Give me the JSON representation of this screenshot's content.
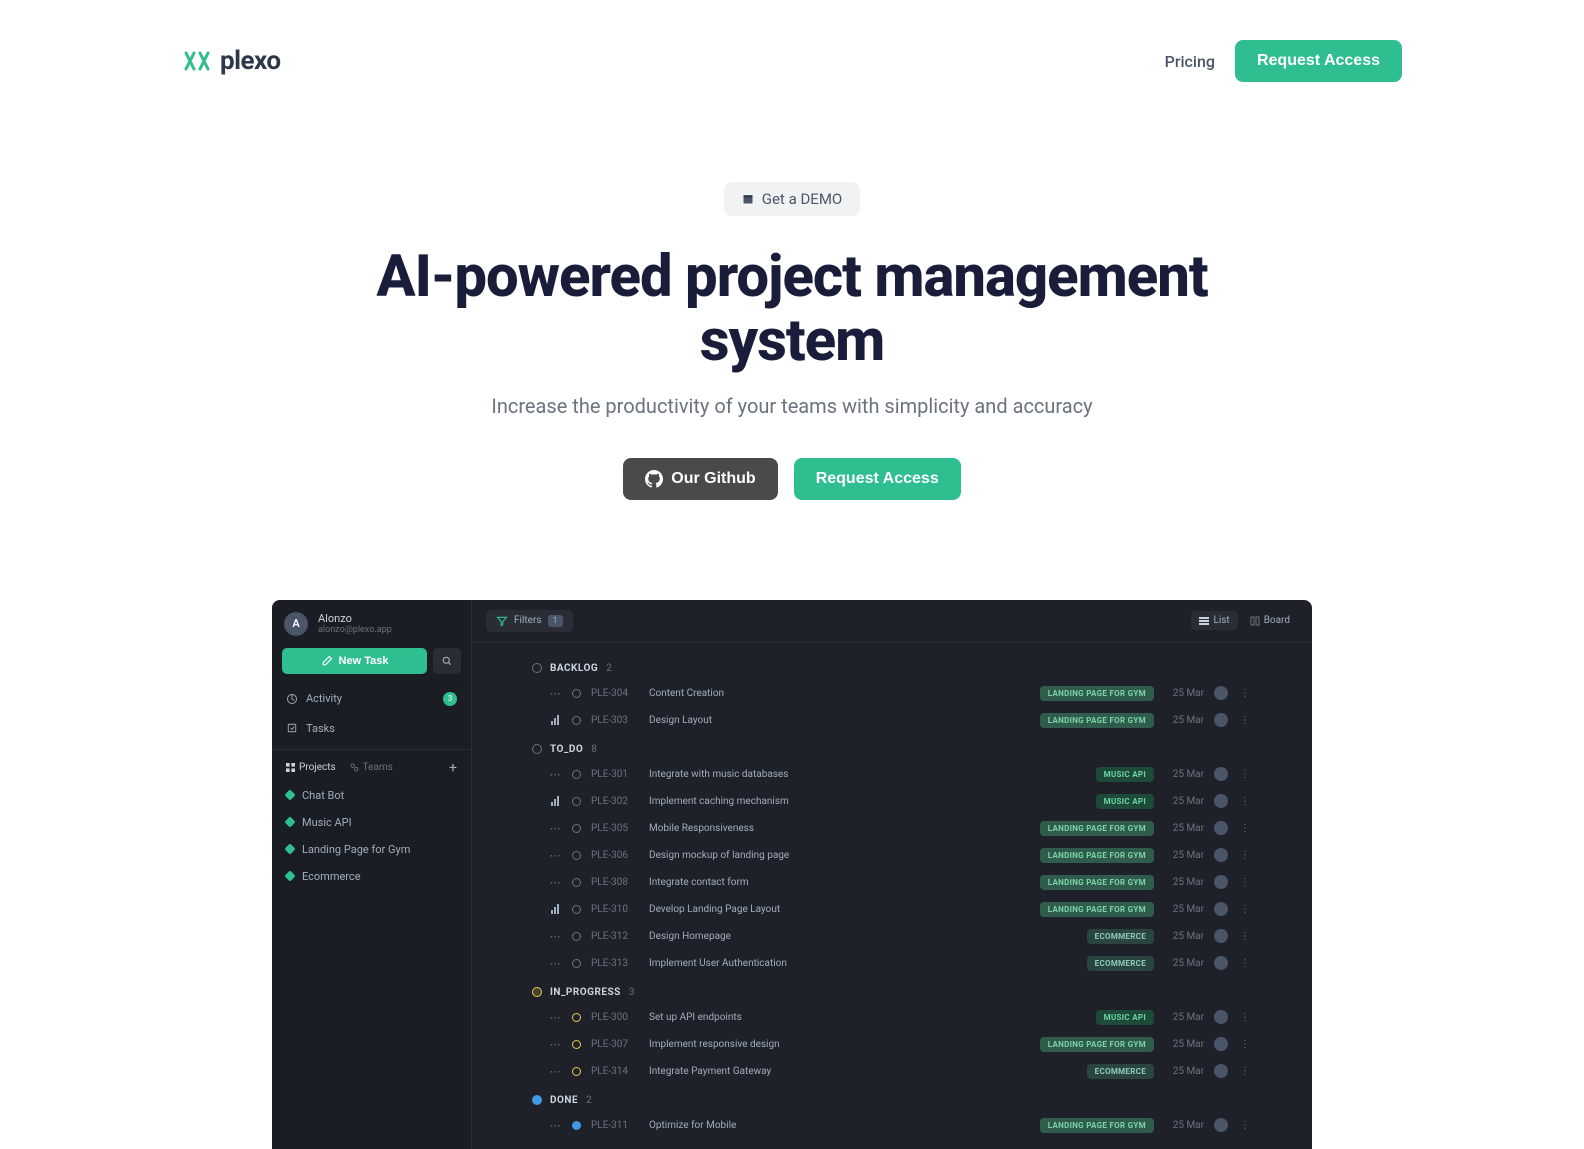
{
  "brand": "plexo",
  "nav": {
    "pricing": "Pricing",
    "request_access": "Request Access"
  },
  "hero": {
    "demo_label": "Get a DEMO",
    "title": "AI-powered project management system",
    "subtitle": "Increase the productivity of your teams with simplicity and accuracy",
    "github_btn": "Our Github",
    "request_btn": "Request Access"
  },
  "app": {
    "user": {
      "initial": "A",
      "name": "Alonzo",
      "email": "alonzo@plexo.app"
    },
    "new_task": "New Task",
    "side_nav": {
      "activity": "Activity",
      "activity_count": "3",
      "tasks": "Tasks"
    },
    "side_tabs": {
      "projects": "Projects",
      "teams": "Teams"
    },
    "projects": [
      "Chat Bot",
      "Music API",
      "Landing Page for Gym",
      "Ecommerce"
    ],
    "filters": {
      "label": "Filters",
      "count": "1"
    },
    "views": {
      "list": "List",
      "board": "Board"
    },
    "sections": [
      {
        "key": "backlog",
        "label": "BACKLOG",
        "count": "2",
        "status": "default",
        "tasks": [
          {
            "pri": "dots",
            "id": "PLE-304",
            "title": "Content Creation",
            "tag": "LANDING PAGE FOR GYM",
            "tagcls": "gym",
            "date": "25 Mar"
          },
          {
            "pri": "bars",
            "id": "PLE-303",
            "title": "Design Layout",
            "tag": "LANDING PAGE FOR GYM",
            "tagcls": "gym",
            "date": "25 Mar"
          }
        ]
      },
      {
        "key": "todo",
        "label": "TO_DO",
        "count": "8",
        "status": "default",
        "tasks": [
          {
            "pri": "dots",
            "id": "PLE-301",
            "title": "Integrate with music databases",
            "tag": "MUSIC API",
            "tagcls": "music",
            "date": "25 Mar"
          },
          {
            "pri": "bars",
            "id": "PLE-302",
            "title": "Implement caching mechanism",
            "tag": "MUSIC API",
            "tagcls": "music",
            "date": "25 Mar"
          },
          {
            "pri": "dots",
            "id": "PLE-305",
            "title": "Mobile Responsiveness",
            "tag": "LANDING PAGE FOR GYM",
            "tagcls": "gym",
            "date": "25 Mar"
          },
          {
            "pri": "dots",
            "id": "PLE-306",
            "title": "Design mockup of landing page",
            "tag": "LANDING PAGE FOR GYM",
            "tagcls": "gym",
            "date": "25 Mar"
          },
          {
            "pri": "dots",
            "id": "PLE-308",
            "title": "Integrate contact form",
            "tag": "LANDING PAGE FOR GYM",
            "tagcls": "gym",
            "date": "25 Mar"
          },
          {
            "pri": "bars",
            "id": "PLE-310",
            "title": "Develop Landing Page Layout",
            "tag": "LANDING PAGE FOR GYM",
            "tagcls": "gym",
            "date": "25 Mar"
          },
          {
            "pri": "dots",
            "id": "PLE-312",
            "title": "Design Homepage",
            "tag": "ECOMMERCE",
            "tagcls": "ecom",
            "date": "25 Mar"
          },
          {
            "pri": "dots",
            "id": "PLE-313",
            "title": "Implement User Authentication",
            "tag": "ECOMMERCE",
            "tagcls": "ecom",
            "date": "25 Mar"
          }
        ]
      },
      {
        "key": "in_progress",
        "label": "IN_PROGRESS",
        "count": "3",
        "status": "yellow",
        "tasks": [
          {
            "pri": "dots",
            "st": "prog",
            "id": "PLE-300",
            "title": "Set up API endpoints",
            "tag": "MUSIC API",
            "tagcls": "music",
            "date": "25 Mar"
          },
          {
            "pri": "dots",
            "st": "prog",
            "id": "PLE-307",
            "title": "Implement responsive design",
            "tag": "LANDING PAGE FOR GYM",
            "tagcls": "gym",
            "date": "25 Mar"
          },
          {
            "pri": "dots",
            "st": "prog",
            "id": "PLE-314",
            "title": "Integrate Payment Gateway",
            "tag": "ECOMMERCE",
            "tagcls": "ecom",
            "date": "25 Mar"
          }
        ]
      },
      {
        "key": "done",
        "label": "DONE",
        "count": "2",
        "status": "done",
        "tasks": [
          {
            "pri": "dots",
            "st": "done",
            "id": "PLE-311",
            "title": "Optimize for Mobile",
            "tag": "LANDING PAGE FOR GYM",
            "tagcls": "gym",
            "date": "25 Mar"
          }
        ]
      }
    ]
  }
}
